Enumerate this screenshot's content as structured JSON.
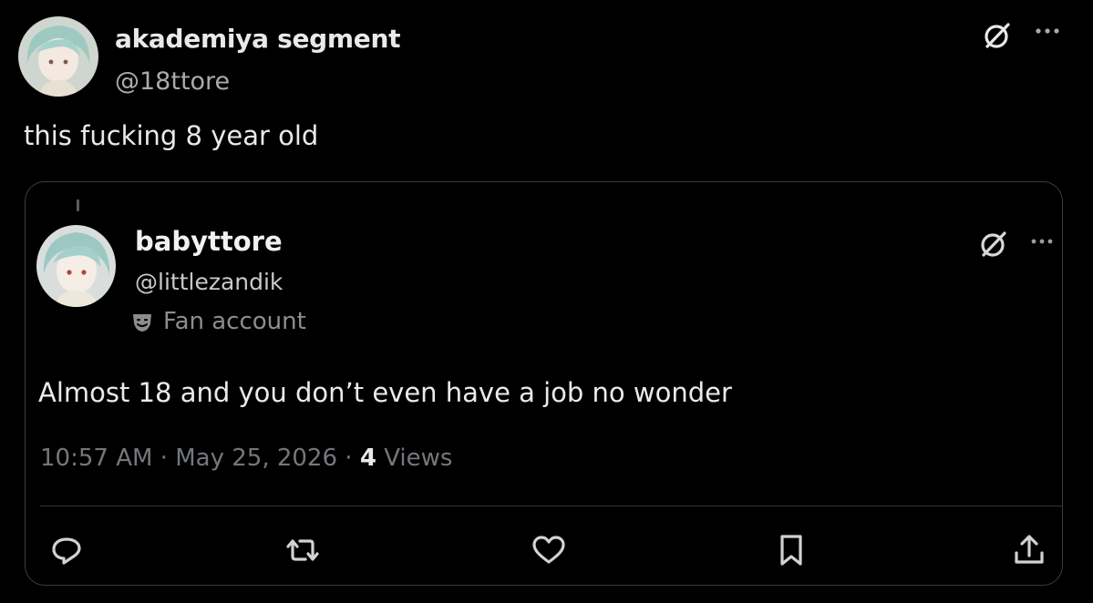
{
  "tweet": {
    "author": {
      "display_name": "akademiya segment",
      "handle": "@18ttore"
    },
    "text": "this fucking 8 year old",
    "quoted": {
      "author": {
        "display_name": "babyttore",
        "handle": "@littlezandik",
        "badge_label": "Fan account"
      },
      "text": "Almost 18 and you don’t even have a job no wonder",
      "time": "10:57 AM",
      "date": "May 25, 2026",
      "views_count": "4",
      "views_label": "Views"
    }
  },
  "icons": {
    "grok": "grok-icon",
    "more": "more-icon",
    "fan": "theater-mask-icon",
    "reply": "reply-icon",
    "retweet": "retweet-icon",
    "like": "heart-icon",
    "bookmark": "bookmark-icon",
    "share": "share-icon"
  },
  "colors": {
    "background": "#000000",
    "text_primary": "#e7e9ea",
    "text_secondary": "#71767b",
    "border": "#2f3336"
  }
}
